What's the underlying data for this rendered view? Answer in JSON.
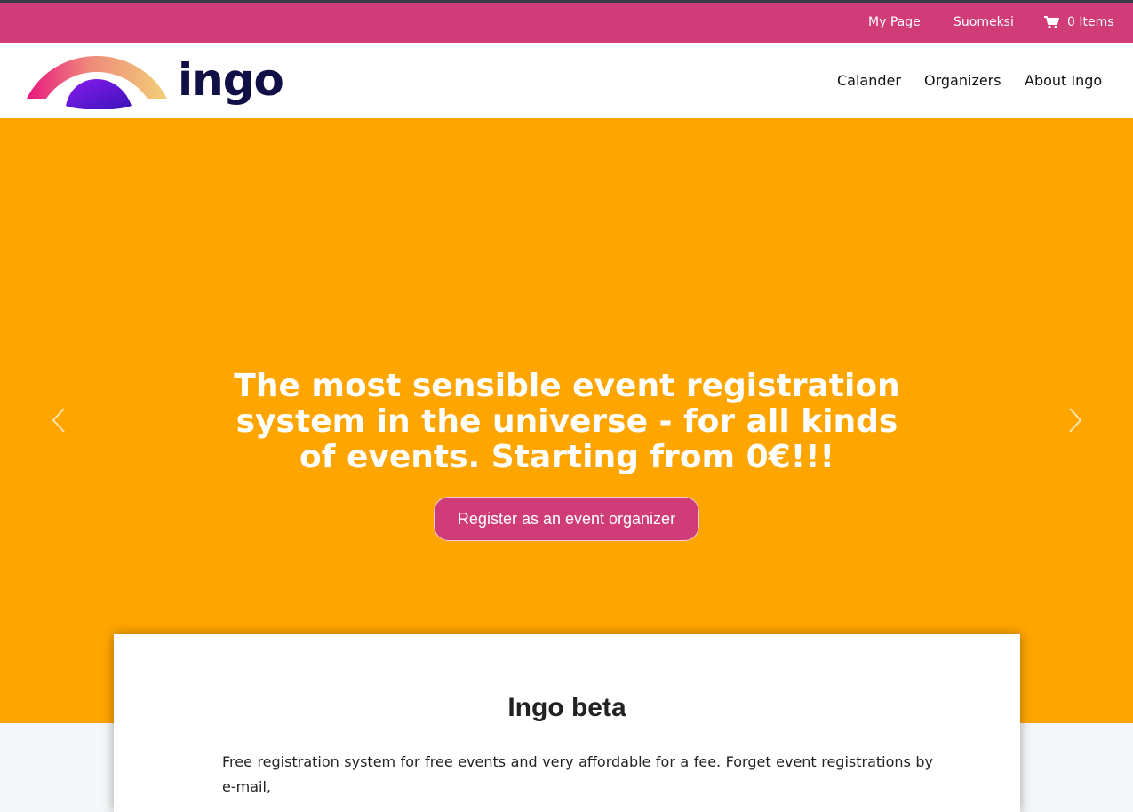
{
  "topbar": {
    "my_page": "My Page",
    "language": "Suomeksi",
    "cart_items": "0 Items",
    "cart_icon": "shopping-cart-icon",
    "background": "#cf3c78"
  },
  "navbar": {
    "logo_text": "ingo",
    "items": [
      "Calander",
      "Organizers",
      "About Ingo"
    ]
  },
  "hero": {
    "background": "#ffa500",
    "title": "The most sensible event registration system in the universe - for all kinds of events. Starting from 0€!!!",
    "cta_label": "Register as an event organizer",
    "prev_icon": "chevron-left-icon",
    "next_icon": "chevron-right-icon"
  },
  "intro": {
    "heading": "Ingo beta",
    "text": "Free registration system for free events and very affordable for a fee. Forget event registrations by e-mail,"
  }
}
